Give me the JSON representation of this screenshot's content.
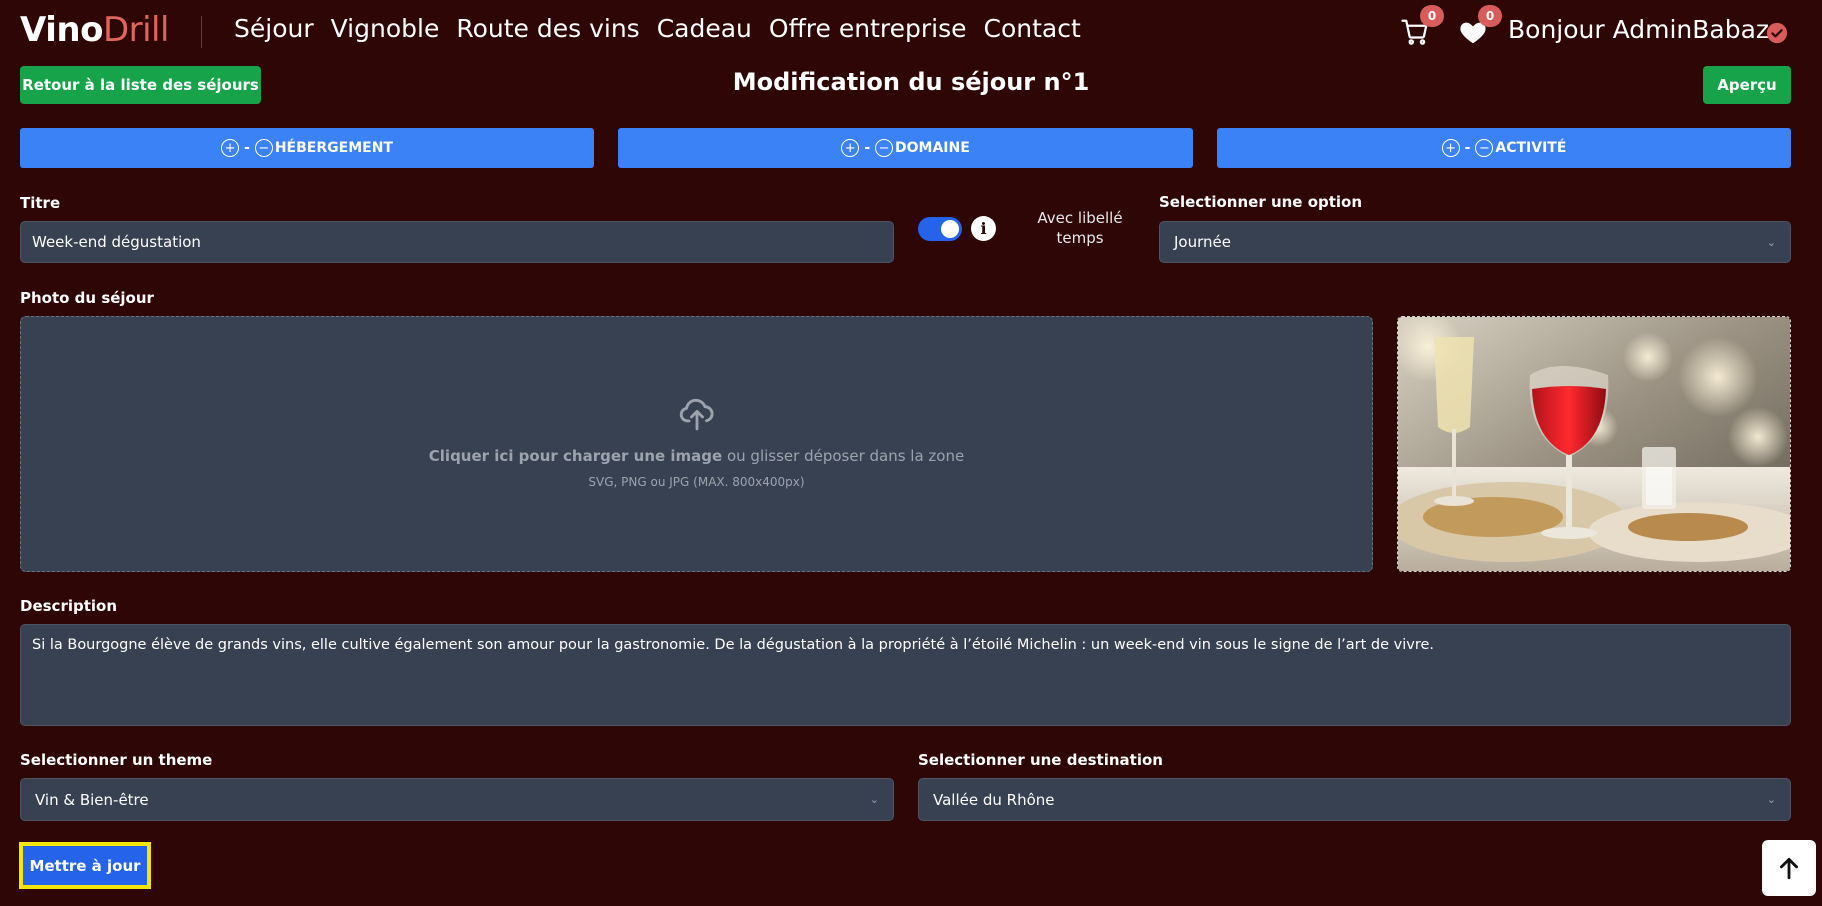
{
  "brand": {
    "part1": "Vino",
    "part2": "Drill"
  },
  "nav": [
    "Séjour",
    "Vignoble",
    "Route des vins",
    "Cadeau",
    "Offre entreprise",
    "Contact"
  ],
  "cart_count": "0",
  "wishlist_count": "0",
  "greeting": "Bonjour AdminBabaz",
  "back_label": "Retour à la liste des séjours",
  "page_title": "Modification du séjour n°1",
  "preview_label": "Aperçu",
  "tabs": [
    {
      "plus": "+",
      "dash": "-",
      "minus": "−",
      "label": "HÉBERGEMENT"
    },
    {
      "plus": "+",
      "dash": "-",
      "minus": "−",
      "label": "DOMAINE"
    },
    {
      "plus": "+",
      "dash": "-",
      "minus": "−",
      "label": "ACTIVITÉ"
    }
  ],
  "form": {
    "title_label": "Titre",
    "title_value": "Week-end dégustation",
    "time_label_line1": "Avec libellé",
    "time_label_line2": "temps",
    "option_label": "Selectionner une option",
    "option_value": "Journée",
    "photo_label": "Photo du séjour",
    "upload_strong": "Cliquer ici pour charger une image",
    "upload_rest": " ou glisser déposer dans la zone",
    "upload_hint": "SVG, PNG ou JPG (MAX. 800x400px)",
    "description_label": "Description",
    "description_value": "Si la Bourgogne élève de grands vins, elle cultive également son amour pour la gastronomie. De la dégustation à la propriété à l’étoilé Michelin : un week-end vin sous le signe de l’art de vivre.",
    "theme_label": "Selectionner un theme",
    "theme_value": "Vin & Bien-être",
    "destination_label": "Selectionner une destination",
    "destination_value": "Vallée du Rhône",
    "submit_label": "Mettre à jour"
  },
  "colors": {
    "background": "#2f0606",
    "accent_blue": "#3b82f6",
    "green": "#16a34a",
    "brand_red": "#e0665a",
    "field_bg": "#374151",
    "highlight_yellow": "#f5e50a"
  },
  "icons": [
    "cart-icon",
    "heart-icon",
    "verified-check-icon",
    "plus-circle-icon",
    "minus-circle-icon",
    "info-icon",
    "upload-cloud-icon",
    "chevron-down-icon",
    "arrow-up-icon"
  ]
}
